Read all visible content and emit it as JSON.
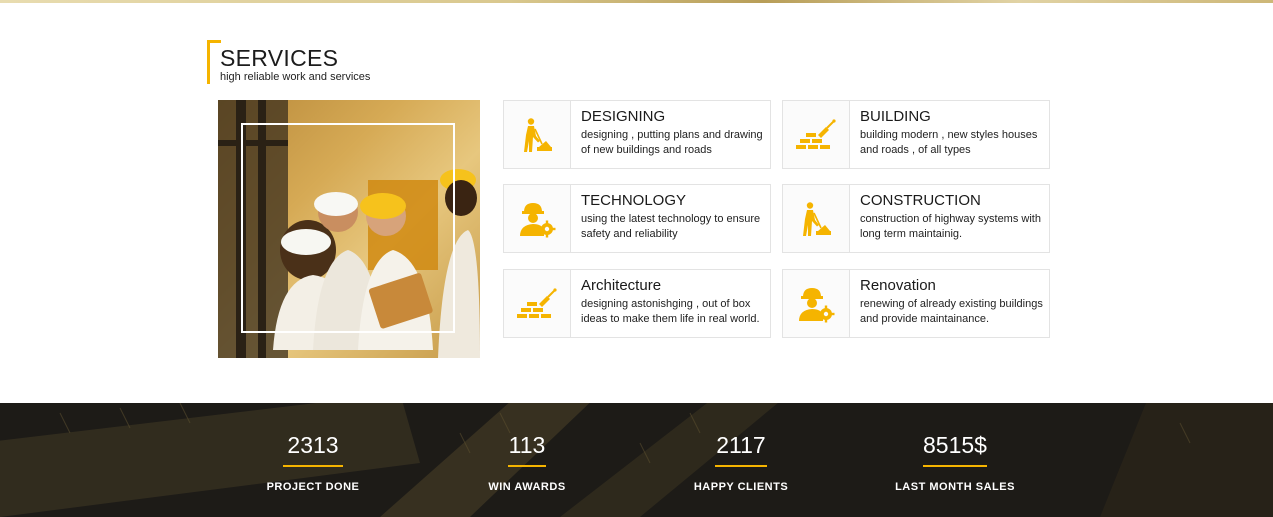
{
  "services": {
    "title": "SERVICES",
    "subtitle": "high reliable work and services",
    "cards": [
      {
        "title": "DESIGNING",
        "desc": "designing , putting plans and drawing of new buildings and roads",
        "icon": "worker-digging-icon"
      },
      {
        "title": "BUILDING",
        "desc": "building modern , new styles houses and roads , of all types",
        "icon": "brick-trowel-icon"
      },
      {
        "title": "TECHNOLOGY",
        "desc": "using the latest technology to ensure safety and reliability",
        "icon": "engineer-gear-icon"
      },
      {
        "title": "CONSTRUCTION",
        "desc": "construction of highway systems with long term maintainig.",
        "icon": "worker-digging-icon"
      },
      {
        "title": "Architecture",
        "desc": "designing astonishging , out of box ideas to make them life in real world.",
        "icon": "brick-trowel-icon"
      },
      {
        "title": "Renovation",
        "desc": "renewing of already existing buildings and provide maintainance.",
        "icon": "engineer-gear-icon"
      }
    ]
  },
  "stats": [
    {
      "value": "2313",
      "label": "PROJECT DONE"
    },
    {
      "value": "113",
      "label": "WIN AWARDS"
    },
    {
      "value": "2117",
      "label": "HAPPY CLIENTS"
    },
    {
      "value": "8515$",
      "label": "LAST MONTH SALES"
    }
  ],
  "colors": {
    "accent": "#f5b400",
    "dark_band": "#1d1b17"
  }
}
